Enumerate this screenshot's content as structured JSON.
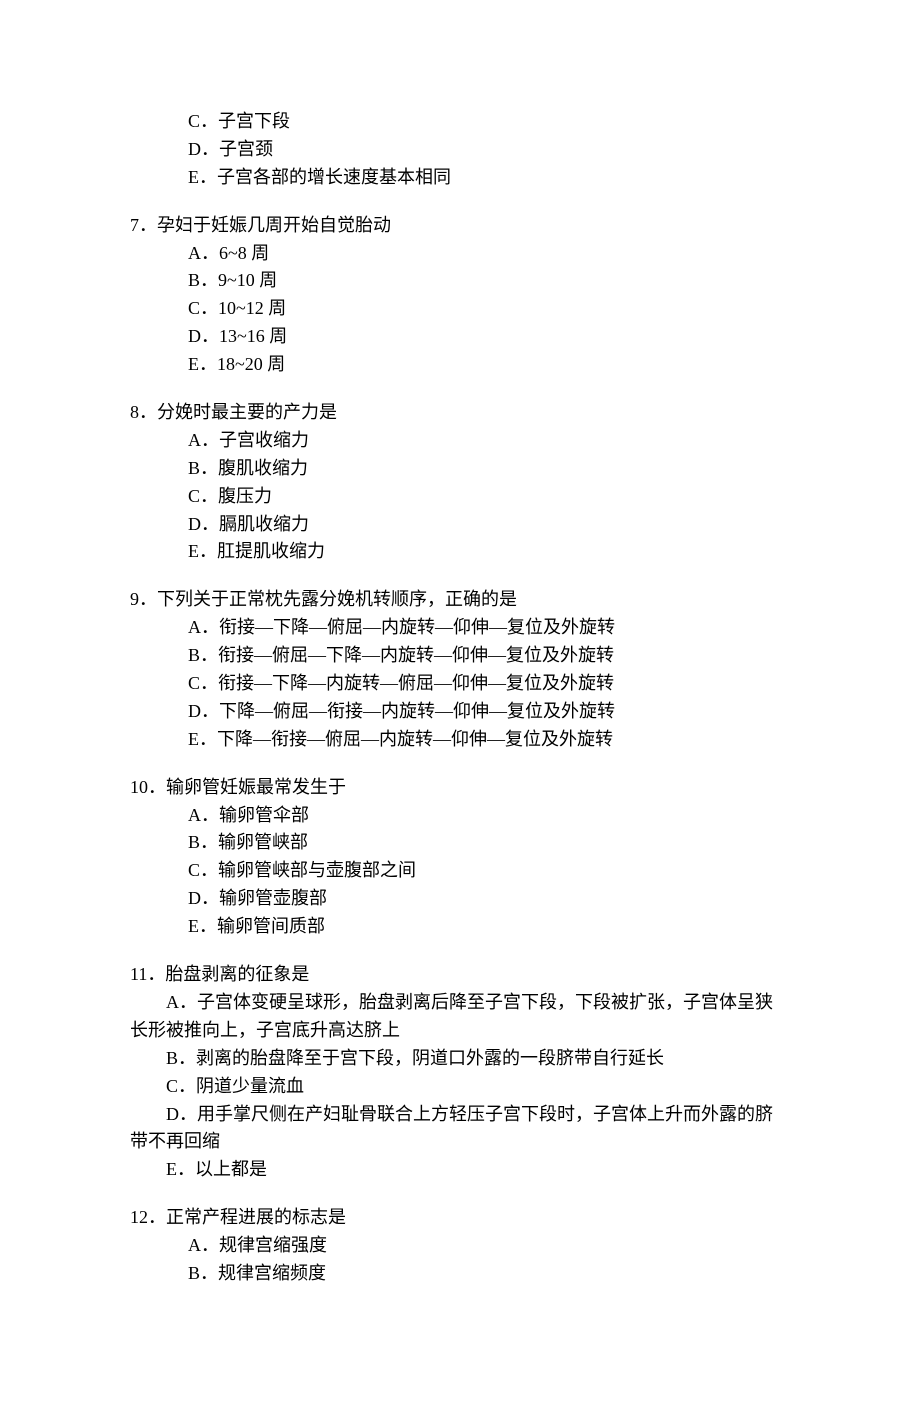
{
  "orphan": {
    "c": "C．子宫下段",
    "d": "D．子宫颈",
    "e": "E．子宫各部的增长速度基本相同"
  },
  "q7": {
    "stem": "7．孕妇于妊娠几周开始自觉胎动",
    "a": "A．6~8 周",
    "b": "B．9~10 周",
    "c": "C．10~12 周",
    "d": "D．13~16 周",
    "e": "E．18~20 周"
  },
  "q8": {
    "stem": "8．分娩时最主要的产力是",
    "a": "A．子宫收缩力",
    "b": "B．腹肌收缩力",
    "c": "C．腹压力",
    "d": "D．膈肌收缩力",
    "e": "E．肛提肌收缩力"
  },
  "q9": {
    "stem": "9．下列关于正常枕先露分娩机转顺序，正确的是",
    "a": "A．衔接—下降—俯屈—内旋转—仰伸—复位及外旋转",
    "b": "B．衔接—俯屈—下降—内旋转—仰伸—复位及外旋转",
    "c": "C．衔接—下降—内旋转—俯屈—仰伸—复位及外旋转",
    "d": "D．下降—俯屈—衔接—内旋转—仰伸—复位及外旋转",
    "e": "E．下降—衔接—俯屈—内旋转—仰伸—复位及外旋转"
  },
  "q10": {
    "stem": "10．输卵管妊娠最常发生于",
    "a": "A．输卵管伞部",
    "b": "B．输卵管峡部",
    "c": "C．输卵管峡部与壶腹部之间",
    "d": "D．输卵管壶腹部",
    "e": "E．输卵管间质部"
  },
  "q11": {
    "stem": "11．胎盘剥离的征象是",
    "a": "　　A．子宫体变硬呈球形，胎盘剥离后降至子宫下段，下段被扩张，子宫体呈狭长形被推向上，子宫底升高达脐上",
    "b": "　　B．剥离的胎盘降至于宫下段，阴道口外露的一段脐带自行延长",
    "c": "　　C．阴道少量流血",
    "d": "　　D．用手掌尺侧在产妇耻骨联合上方轻压子宫下段时，子宫体上升而外露的脐带不再回缩",
    "e": "　　E．以上都是"
  },
  "q12": {
    "stem": "12．正常产程进展的标志是",
    "a": "A．规律宫缩强度",
    "b": "B．规律宫缩频度"
  }
}
